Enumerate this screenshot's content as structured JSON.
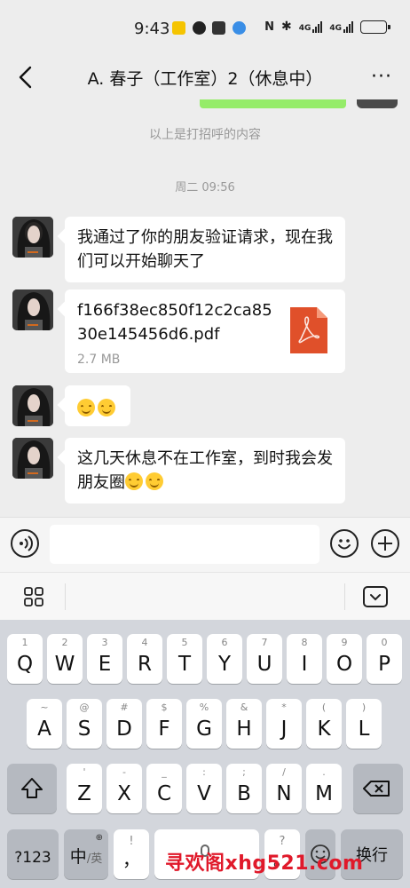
{
  "status_bar": {
    "time": "9:43",
    "net_label_1": "4G",
    "net_label_2": "4G"
  },
  "header": {
    "title": "A. 春子（工作室）2（休息中）",
    "more_label": "···"
  },
  "chat": {
    "system_note": "以上是打招呼的内容",
    "timestamp": "周二 09:56",
    "messages": [
      {
        "type": "text",
        "text": "我通过了你的朋友验证请求，现在我们可以开始聊天了"
      },
      {
        "type": "file",
        "file_name": "f166f38ec850f12c2ca8530e145456d6.pdf",
        "file_size": "2.7 MB"
      },
      {
        "type": "emoji",
        "emojis": [
          "smile-emoji",
          "smile-emoji"
        ]
      },
      {
        "type": "text_with_emoji",
        "text": "这几天休息不在工作室，到时我会发朋友圈",
        "emojis": [
          "smile-emoji",
          "smile-emoji"
        ]
      }
    ]
  },
  "input_bar": {
    "placeholder": ""
  },
  "keyboard": {
    "row1": [
      {
        "main": "Q",
        "sub": "1"
      },
      {
        "main": "W",
        "sub": "2"
      },
      {
        "main": "E",
        "sub": "3"
      },
      {
        "main": "R",
        "sub": "4"
      },
      {
        "main": "T",
        "sub": "5"
      },
      {
        "main": "Y",
        "sub": "6"
      },
      {
        "main": "U",
        "sub": "7"
      },
      {
        "main": "I",
        "sub": "8"
      },
      {
        "main": "O",
        "sub": "9"
      },
      {
        "main": "P",
        "sub": "0"
      }
    ],
    "row2": [
      {
        "main": "A",
        "sub": "~"
      },
      {
        "main": "S",
        "sub": "@"
      },
      {
        "main": "D",
        "sub": "#"
      },
      {
        "main": "F",
        "sub": "$"
      },
      {
        "main": "G",
        "sub": "%"
      },
      {
        "main": "H",
        "sub": "&"
      },
      {
        "main": "J",
        "sub": "*"
      },
      {
        "main": "K",
        "sub": "("
      },
      {
        "main": "L",
        "sub": ")"
      }
    ],
    "row3": [
      {
        "main": "Z",
        "sub": "'"
      },
      {
        "main": "X",
        "sub": "-"
      },
      {
        "main": "C",
        "sub": "_"
      },
      {
        "main": "V",
        "sub": ":"
      },
      {
        "main": "B",
        "sub": ";"
      },
      {
        "main": "N",
        "sub": "/"
      },
      {
        "main": "M",
        "sub": "."
      }
    ],
    "num_key": "?123",
    "lang_key": "中",
    "lang_key_sub": "/英",
    "punct_key": "，",
    "punct_key_sub": "!",
    "period_key": "。",
    "period_key_sub": "?",
    "enter_key": "换行"
  },
  "watermark": "寻欢阁xhg521.com",
  "colors": {
    "accent_green": "#95ec69",
    "watermark_red": "#e0192a",
    "pdf_red": "#e0502a"
  }
}
